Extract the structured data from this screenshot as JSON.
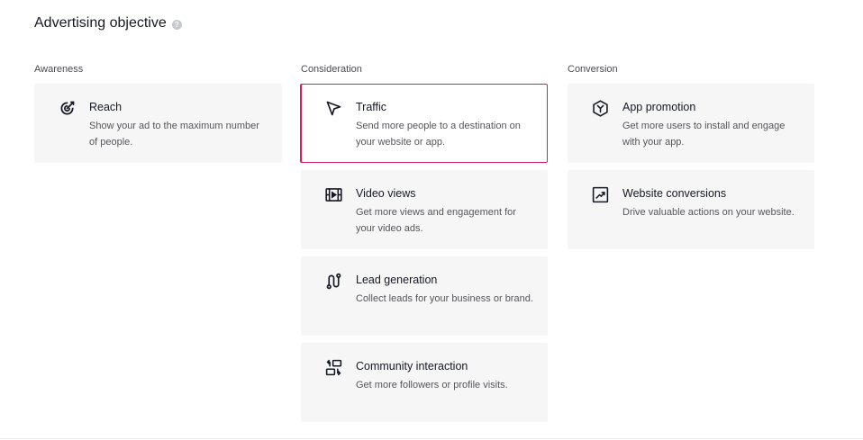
{
  "page": {
    "title": "Advertising objective",
    "help_icon": "question-circle-icon"
  },
  "columns": {
    "awareness": {
      "heading": "Awareness",
      "cards": [
        {
          "label": "Reach",
          "desc": "Show your ad to the maximum number of people.",
          "icon": "target-icon"
        }
      ]
    },
    "consideration": {
      "heading": "Consideration",
      "cards": [
        {
          "label": "Traffic",
          "desc": "Send more people to a destination on your website or app.",
          "icon": "cursor-arrow-icon",
          "selected": true
        },
        {
          "label": "Video views",
          "desc": "Get more views and engagement for your video ads.",
          "icon": "film-play-icon"
        },
        {
          "label": "Lead generation",
          "desc": "Collect leads for your business or brand.",
          "icon": "route-path-icon"
        },
        {
          "label": "Community interaction",
          "desc": "Get more followers or profile visits.",
          "icon": "swap-boxes-icon"
        }
      ]
    },
    "conversion": {
      "heading": "Conversion",
      "cards": [
        {
          "label": "App promotion",
          "desc": "Get more users to install and engage with your app.",
          "icon": "app-hexagon-icon"
        },
        {
          "label": "Website conversions",
          "desc": "Drive valuable actions on your website.",
          "icon": "trend-up-icon"
        }
      ]
    }
  },
  "colors": {
    "selected_border": "#e1185e",
    "card_bg": "#f6f6f6"
  }
}
